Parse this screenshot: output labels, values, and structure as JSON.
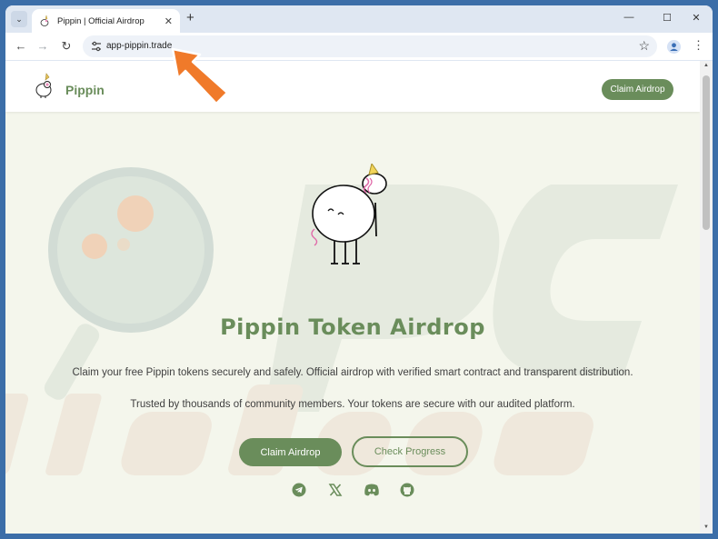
{
  "browser": {
    "tab": {
      "title": "Pippin | Official Airdrop",
      "close": "✕"
    },
    "new_tab": "+",
    "window_controls": {
      "minimize": "—",
      "maximize": "☐",
      "close": "✕"
    },
    "nav": {
      "back": "←",
      "forward": "→",
      "reload": "↻"
    },
    "url": "app-pippin.trade",
    "bookmark": "☆",
    "menu": "⋮"
  },
  "site": {
    "brand": "Pippin",
    "header_button": "Claim Airdrop",
    "hero": {
      "title": "Pippin Token Airdrop",
      "description": "Claim your free Pippin tokens securely and safely. Official airdrop with verified smart contract and transparent distribution.",
      "trust": "Trusted by thousands of community members. Your tokens are secure with our audited platform."
    },
    "buttons": {
      "primary": "Claim Airdrop",
      "secondary": "Check Progress"
    },
    "social_icons": [
      "telegram-icon",
      "x-icon",
      "discord-icon",
      "github-icon"
    ]
  },
  "colors": {
    "accent": "#6a8d5b",
    "page_bg": "#f4f6ec",
    "annotation": "#f07a2a"
  }
}
